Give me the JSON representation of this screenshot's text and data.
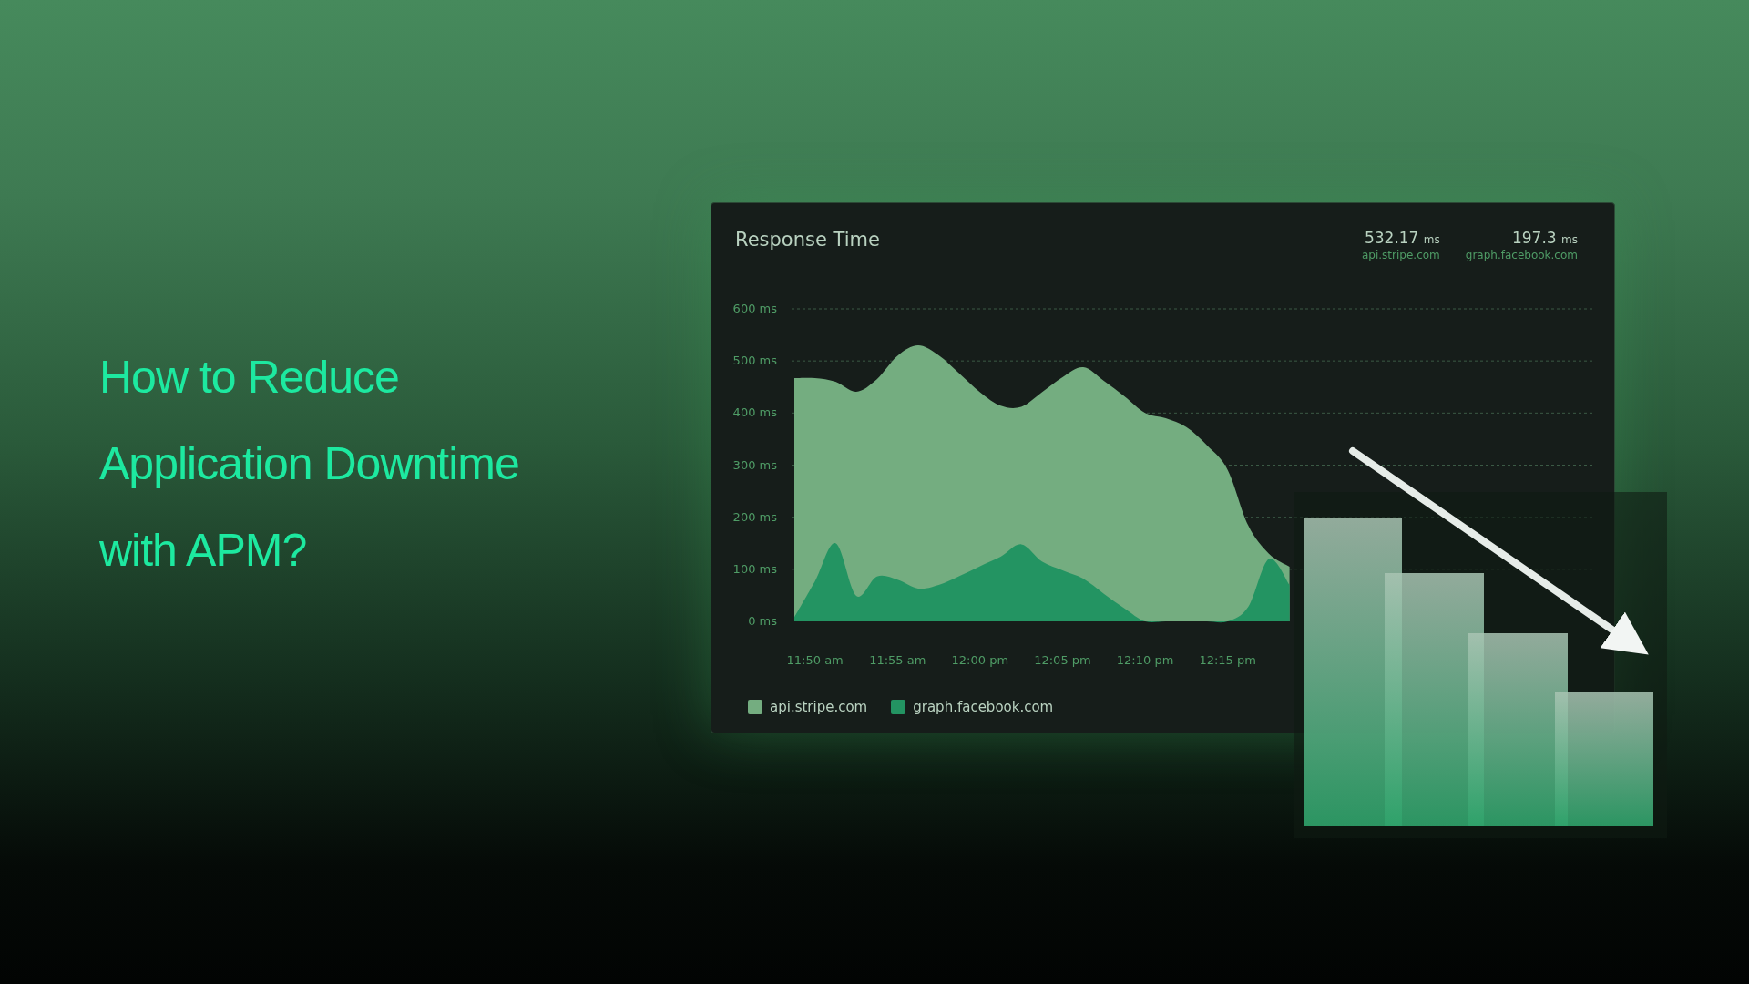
{
  "headline": "How to Reduce Application Downtime with APM?",
  "panel": {
    "title": "Response Time",
    "stats": [
      {
        "value": "532.17",
        "unit": "ms",
        "label": "api.stripe.com"
      },
      {
        "value": "197.3",
        "unit": "ms",
        "label": "graph.facebook.com"
      }
    ],
    "chart_data": {
      "type": "area",
      "categories": [
        null,
        "11:50 am",
        null,
        null,
        null,
        "11:55 am",
        null,
        null,
        null,
        "12:00 pm",
        null,
        null,
        null,
        "12:05 pm",
        null,
        null,
        null,
        "12:10 pm",
        null,
        null,
        null,
        "12:15 pm",
        null,
        null,
        null
      ],
      "series": [
        {
          "name": "api.stripe.com",
          "color": "#74ad80",
          "values": [
            467,
            467,
            460,
            441,
            465,
            510,
            530,
            511,
            476,
            440,
            414,
            412,
            440,
            469,
            488,
            462,
            432,
            400,
            390,
            373,
            338,
            291,
            184,
            130,
            105
          ]
        },
        {
          "name": "graph.facebook.com",
          "color": "#239462",
          "values": [
            8,
            77,
            150,
            49,
            86,
            80,
            63,
            70,
            87,
            106,
            124,
            148,
            115,
            98,
            82,
            53,
            25,
            0,
            0,
            0,
            0,
            0,
            28,
            120,
            70
          ]
        }
      ],
      "grid": true,
      "ylim": [
        0,
        600
      ],
      "yticks": [
        {
          "value": 0,
          "label": "0 ms"
        },
        {
          "value": 100,
          "label": "100 ms"
        },
        {
          "value": 200,
          "label": "200 ms"
        },
        {
          "value": 300,
          "label": "300 ms"
        },
        {
          "value": 400,
          "label": "400 ms"
        },
        {
          "value": 500,
          "label": "500 ms"
        },
        {
          "value": 600,
          "label": "600 ms"
        }
      ]
    }
  }
}
